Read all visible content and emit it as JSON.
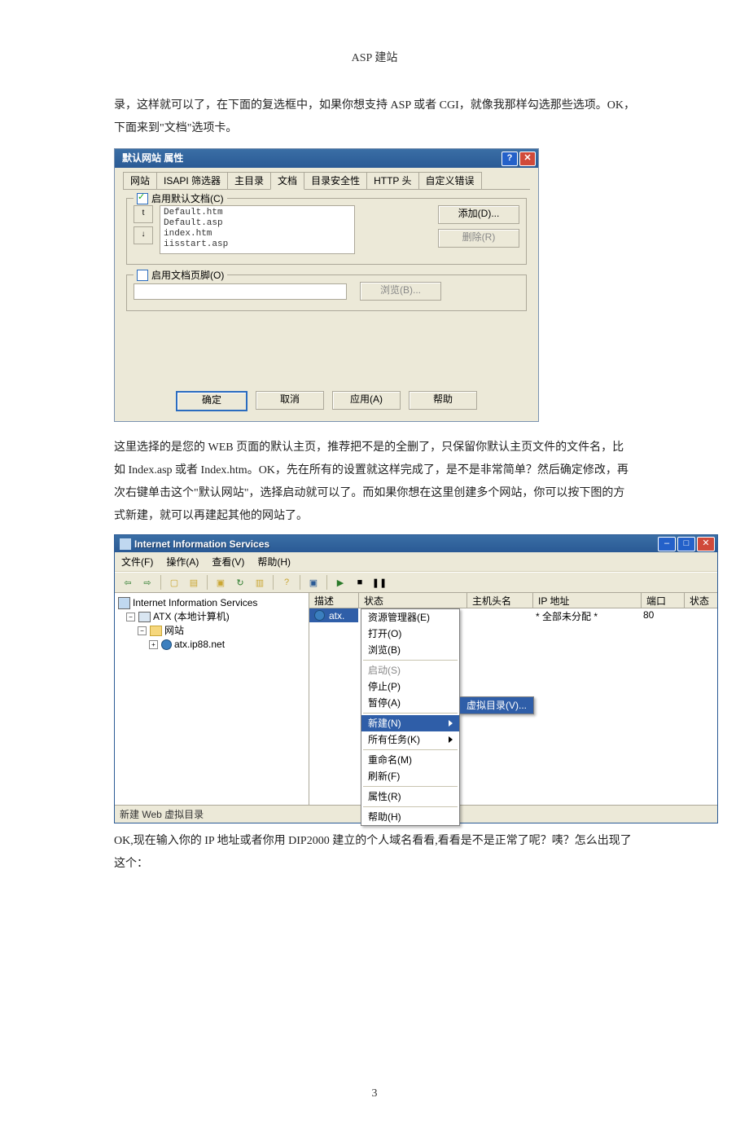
{
  "doc": {
    "header": "ASP 建站",
    "para1": "录，这样就可以了，在下面的复选框中，如果你想支持 ASP 或者 CGI，就像我那样勾选那些选项。OK，下面来到\"文档\"选项卡。",
    "para2": "这里选择的是您的 WEB 页面的默认主页，推荐把不是的全删了，只保留你默认主页文件的文件名，比如 Index.asp 或者 Index.htm。OK，先在所有的设置就这样完成了，是不是非常简单？然后确定修改，再次右键单击这个\"默认网站\"，选择启动就可以了。而如果你想在这里创建多个网站，你可以按下图的方式新建，就可以再建起其他的网站了。",
    "para3": "OK,现在输入你的 IP 地址或者你用 DIP2000 建立的个人域名看看,看看是不是正常了呢？咦？怎么出现了这个：",
    "pagenum": "3"
  },
  "dlg1": {
    "title": "默认网站 属性",
    "tabs": [
      "网站",
      "ISAPI 筛选器",
      "主目录",
      "文档",
      "目录安全性",
      "HTTP 头",
      "自定义错误"
    ],
    "activeTab": 3,
    "group1": {
      "legend": "启用默认文档(C)",
      "checked": true,
      "up": "↑",
      "down": "↓",
      "items": [
        "Default.htm",
        "Default.asp",
        "index.htm",
        "iisstart.asp"
      ],
      "add": "添加(D)...",
      "del": "删除(R)"
    },
    "group2": {
      "legend": "启用文档页脚(O)",
      "checked": false,
      "browse": "浏览(B)..."
    },
    "ok": "确定",
    "cancel": "取消",
    "apply": "应用(A)",
    "help": "帮助"
  },
  "iis": {
    "title": "Internet Information Services",
    "menu": {
      "file": "文件(F)",
      "action": "操作(A)",
      "view": "查看(V)",
      "help": "帮助(H)"
    },
    "tree": {
      "root": "Internet Information Services",
      "computer": "ATX (本地计算机)",
      "websites": "网站",
      "site": "atx.ip88.net"
    },
    "columns": {
      "desc": "描述",
      "status": "状态",
      "host": "主机头名",
      "ip": "IP 地址",
      "port": "端口",
      "state": "状态"
    },
    "row": {
      "desc": "atx.",
      "ip": "* 全部未分配 *",
      "port": "80"
    },
    "ctx": {
      "explorer": "资源管理器(E)",
      "open": "打开(O)",
      "browse": "浏览(B)",
      "start": "启动(S)",
      "stop": "停止(P)",
      "pause": "暂停(A)",
      "new": "新建(N)",
      "alltask": "所有任务(K)",
      "rename": "重命名(M)",
      "refresh": "刷新(F)",
      "props": "属性(R)",
      "help": "帮助(H)"
    },
    "submenu": "虚拟目录(V)...",
    "status": "新建 Web 虚拟目录"
  }
}
